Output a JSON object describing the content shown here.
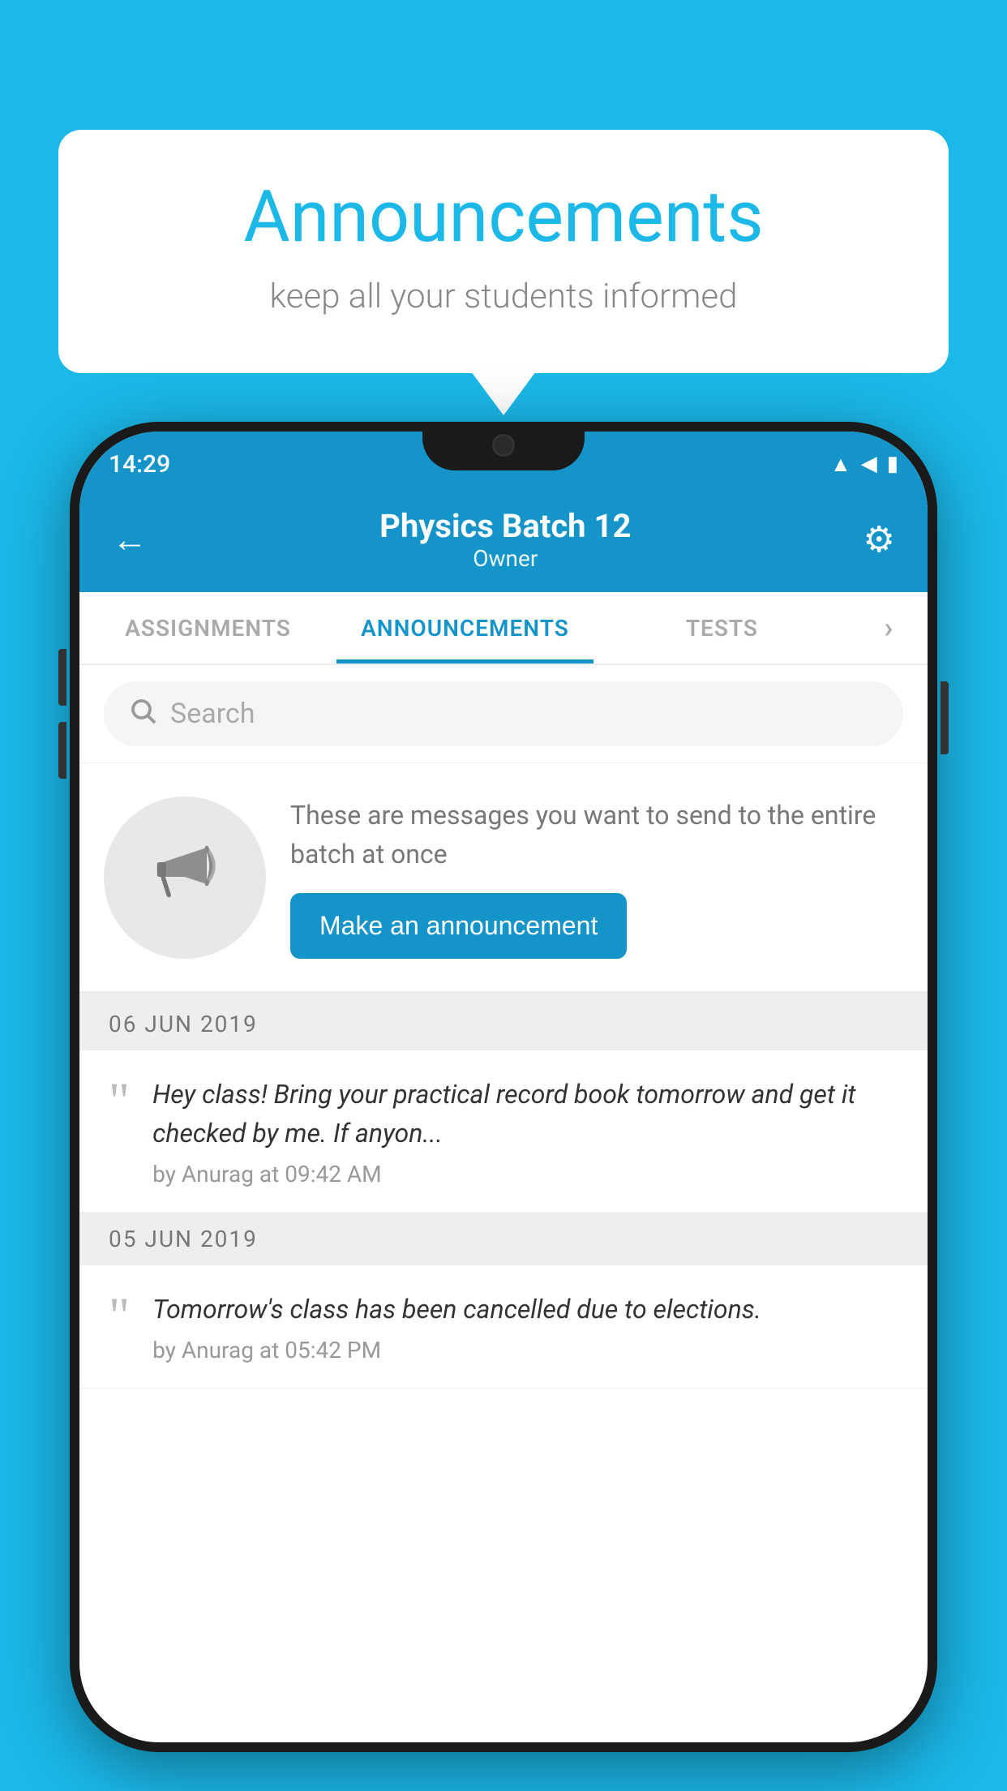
{
  "bubble": {
    "title": "Announcements",
    "subtitle": "keep all your students informed"
  },
  "status_bar": {
    "time": "14:29",
    "wifi": "▲",
    "signal": "▲",
    "battery": "▮"
  },
  "header": {
    "title": "Physics Batch 12",
    "subtitle": "Owner",
    "back_label": "←",
    "gear_label": "⚙"
  },
  "tabs": [
    {
      "label": "ASSIGNMENTS",
      "active": false
    },
    {
      "label": "ANNOUNCEMENTS",
      "active": true
    },
    {
      "label": "TESTS",
      "active": false
    }
  ],
  "search": {
    "placeholder": "Search"
  },
  "promo": {
    "description": "These are messages you want to send to the entire batch at once",
    "button_label": "Make an announcement"
  },
  "announcements": [
    {
      "date": "06  JUN  2019",
      "text": "Hey class! Bring your practical record book tomorrow and get it checked by me. If anyon...",
      "meta": "by Anurag at 09:42 AM"
    },
    {
      "date": "05  JUN  2019",
      "text": "Tomorrow's class has been cancelled due to elections.",
      "meta": "by Anurag at 05:42 PM"
    }
  ],
  "colors": {
    "primary": "#1494C8",
    "background": "#1BB8E8",
    "white": "#ffffff"
  }
}
